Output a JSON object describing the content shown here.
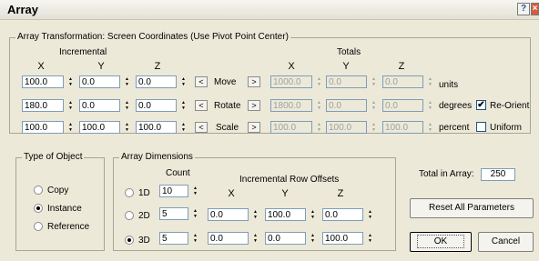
{
  "window": {
    "title": "Array",
    "help_glyph": "?",
    "close_glyph": "×"
  },
  "transformation": {
    "group_label": "Array Transformation: Screen Coordinates (Use Pivot Point Center)",
    "incremental_label": "Incremental",
    "totals_label": "Totals",
    "axes": [
      "X",
      "Y",
      "Z"
    ],
    "left_arrow": "<",
    "right_arrow": ">",
    "rows": [
      {
        "name": "Move",
        "incremental": [
          "100.0",
          "0.0",
          "0.0"
        ],
        "totals": [
          "1000.0",
          "0.0",
          "0.0"
        ],
        "unit": "units"
      },
      {
        "name": "Rotate",
        "incremental": [
          "180.0",
          "0.0",
          "0.0"
        ],
        "totals": [
          "1800.0",
          "0.0",
          "0.0"
        ],
        "unit": "degrees"
      },
      {
        "name": "Scale",
        "incremental": [
          "100.0",
          "100.0",
          "100.0"
        ],
        "totals": [
          "100.0",
          "100.0",
          "100.0"
        ],
        "unit": "percent"
      }
    ],
    "re_orient": {
      "label": "Re-Orient",
      "checked": true,
      "mark": "✔"
    },
    "uniform": {
      "label": "Uniform",
      "checked": false
    }
  },
  "type_of_object": {
    "group_label": "Type of Object",
    "options": [
      {
        "label": "Copy",
        "selected": false
      },
      {
        "label": "Instance",
        "selected": true
      },
      {
        "label": "Reference",
        "selected": false
      }
    ]
  },
  "array_dimensions": {
    "group_label": "Array Dimensions",
    "count_label": "Count",
    "offsets_label": "Incremental Row Offsets",
    "axes": [
      "X",
      "Y",
      "Z"
    ],
    "rows": [
      {
        "label": "1D",
        "count": "10",
        "selected": false,
        "offsets": []
      },
      {
        "label": "2D",
        "count": "5",
        "selected": false,
        "offsets": [
          "0.0",
          "100.0",
          "0.0"
        ]
      },
      {
        "label": "3D",
        "count": "5",
        "selected": true,
        "offsets": [
          "0.0",
          "0.0",
          "100.0"
        ]
      }
    ]
  },
  "total_in_array": {
    "label": "Total in Array:",
    "value": "250"
  },
  "buttons": {
    "reset": "Reset All Parameters",
    "ok": "OK",
    "cancel": "Cancel"
  },
  "colors": {
    "dialog_bg": "#ece9d8",
    "field_border": "#7f9db9",
    "disabled_text": "#a0a0a0"
  }
}
